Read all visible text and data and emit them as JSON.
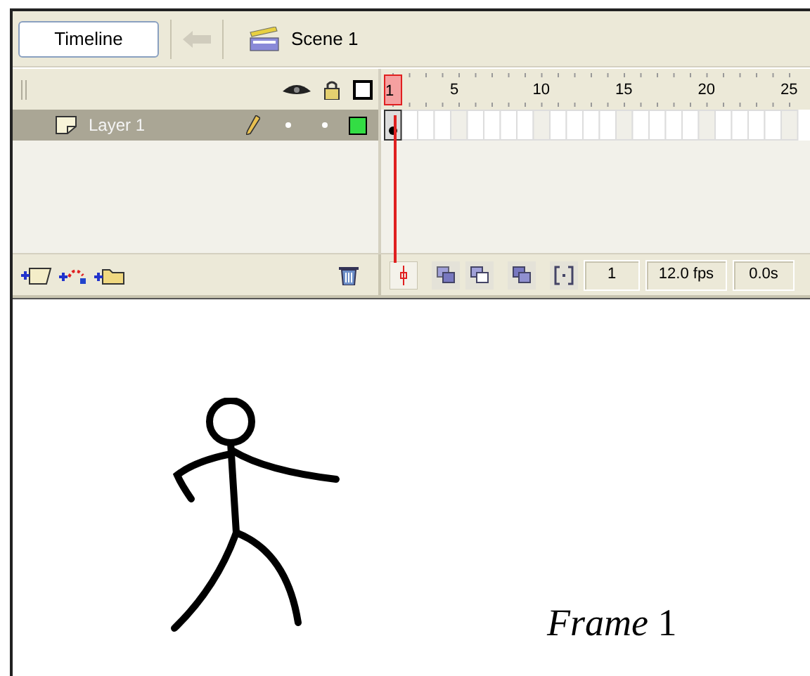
{
  "toolbar": {
    "timeline_button": "Timeline",
    "scene": "Scene 1"
  },
  "ruler": [
    {
      "label": "1",
      "selected": true
    },
    {
      "label": "5",
      "selected": false
    },
    {
      "label": "10",
      "selected": false
    },
    {
      "label": "15",
      "selected": false
    },
    {
      "label": "20",
      "selected": false
    },
    {
      "label": "25",
      "selected": false
    }
  ],
  "layers": [
    {
      "name": "Layer 1",
      "selected": true,
      "color": "#33dd44"
    }
  ],
  "status": {
    "frame": "1",
    "rate": "12.0 fps",
    "time": "0.0s"
  },
  "stage": {
    "caption": "*Frame* 1"
  }
}
